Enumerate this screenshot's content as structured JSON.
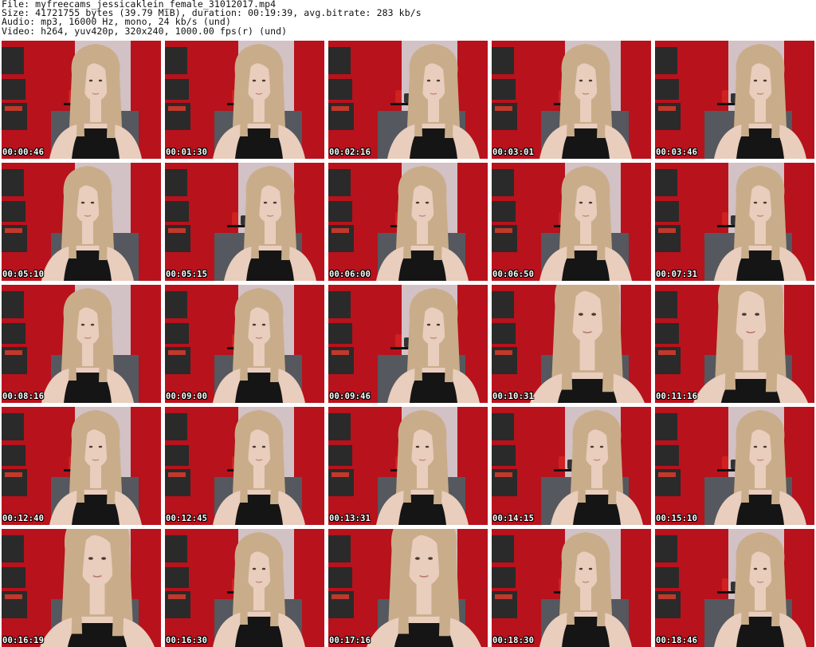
{
  "header": {
    "file_line": "File: myfreecams_jessicaklein_female_31012017.mp4",
    "size_line": "Size: 41721755 bytes (39.79 MiB), duration: 00:19:39, avg.bitrate: 283 kb/s",
    "audio_line": "Audio: mp3, 16000 Hz, mono, 24 kb/s (und)",
    "video_line": "Video: h264, yuv420p, 320x240, 1000.00 fps(r) (und)"
  },
  "thumbnails": [
    {
      "time": "00:00:46",
      "pose": "center"
    },
    {
      "time": "00:01:30",
      "pose": "center"
    },
    {
      "time": "00:02:16",
      "pose": "right"
    },
    {
      "time": "00:03:01",
      "pose": "center"
    },
    {
      "time": "00:03:46",
      "pose": "right"
    },
    {
      "time": "00:05:10",
      "pose": "left"
    },
    {
      "time": "00:05:15",
      "pose": "right"
    },
    {
      "time": "00:06:00",
      "pose": "center"
    },
    {
      "time": "00:06:50",
      "pose": "center"
    },
    {
      "time": "00:07:31",
      "pose": "right"
    },
    {
      "time": "00:08:16",
      "pose": "left"
    },
    {
      "time": "00:09:00",
      "pose": "center"
    },
    {
      "time": "00:09:46",
      "pose": "right"
    },
    {
      "time": "00:10:31",
      "pose": "close"
    },
    {
      "time": "00:11:16",
      "pose": "close"
    },
    {
      "time": "00:12:40",
      "pose": "center"
    },
    {
      "time": "00:12:45",
      "pose": "center"
    },
    {
      "time": "00:13:31",
      "pose": "center"
    },
    {
      "time": "00:14:15",
      "pose": "right"
    },
    {
      "time": "00:15:10",
      "pose": "right"
    },
    {
      "time": "00:16:19",
      "pose": "close"
    },
    {
      "time": "00:16:30",
      "pose": "center"
    },
    {
      "time": "00:17:16",
      "pose": "close"
    },
    {
      "time": "00:18:30",
      "pose": "center"
    },
    {
      "time": "00:18:46",
      "pose": "right"
    }
  ],
  "colors": {
    "wall": "#b8121c",
    "hair": "#c9ad8a",
    "skin": "#e9cdbd",
    "shirt": "#151515",
    "poster": "#2a2a2a",
    "window": "#d5d5d8"
  }
}
